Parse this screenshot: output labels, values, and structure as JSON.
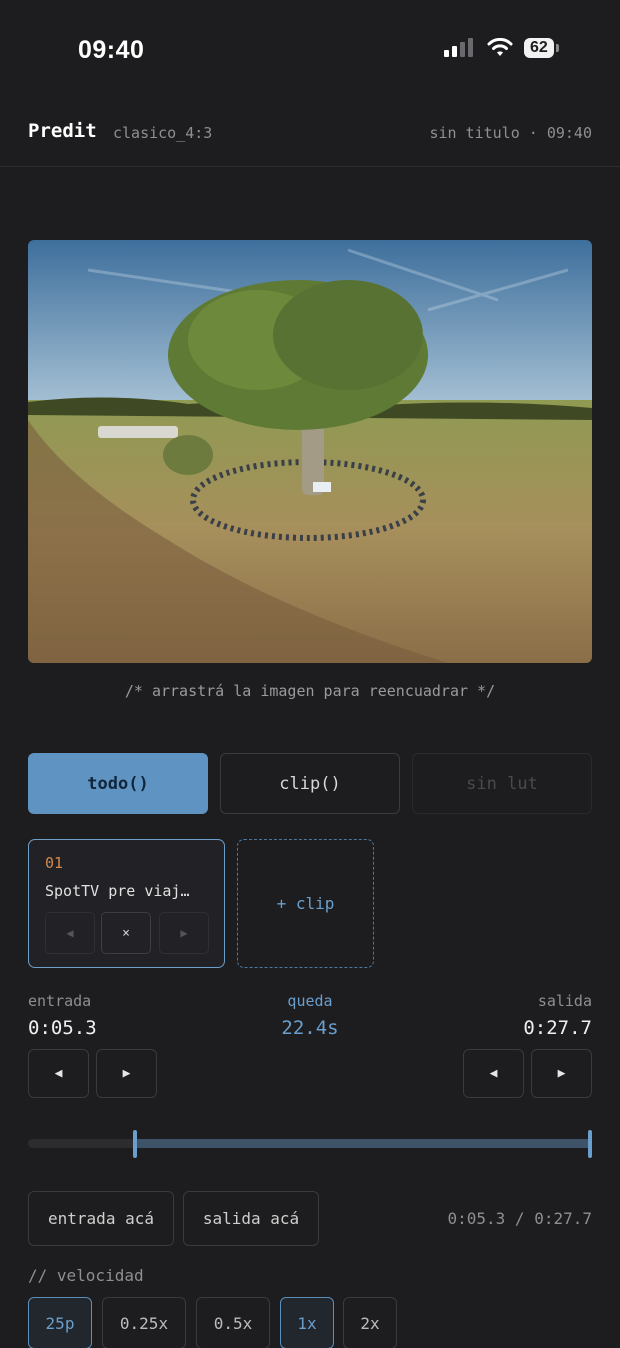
{
  "status_bar": {
    "time": "09:40",
    "battery": "62"
  },
  "header": {
    "brand": "Predit",
    "preset": "clasico_4:3",
    "doc_info": "sin titulo · 09:40"
  },
  "preview": {
    "hint": "/* arrastrá la imagen para reencuadrar */"
  },
  "modes": {
    "todo": "todo()",
    "clip": "clip()",
    "lut": "sin lut"
  },
  "clips": [
    {
      "number": "01",
      "name": "SpotTV pre viaj…"
    }
  ],
  "clip_controls": {
    "prev": "◀",
    "remove": "×",
    "next": "▶"
  },
  "add_clip": "+ clip",
  "trim": {
    "in_label": "entrada",
    "in_value": "0:05.3",
    "remain_label": "queda",
    "remain_value": "22.4s",
    "out_label": "salida",
    "out_value": "0:27.7",
    "step_back": "◀",
    "step_fwd": "▶",
    "in_fraction": 0.19,
    "out_fraction": 1.0
  },
  "set_buttons": {
    "set_in": "entrada acá",
    "set_out": "salida acá"
  },
  "range_text": "0:05.3 / 0:27.7",
  "speed_section": "// velocidad",
  "speed_options": [
    {
      "label": "25p",
      "active": true
    },
    {
      "label": "0.25x",
      "active": false
    },
    {
      "label": "0.5x",
      "active": false
    },
    {
      "label": "1x",
      "active": true
    },
    {
      "label": "2x",
      "active": false
    }
  ]
}
